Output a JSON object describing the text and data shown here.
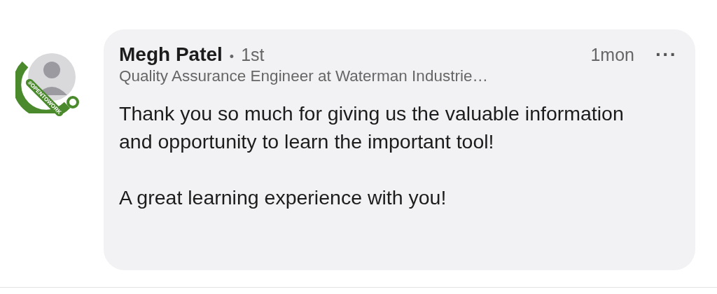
{
  "comment": {
    "author": "Megh Patel",
    "separator": "•",
    "degree": "1st",
    "headline": "Quality Assurance Engineer at Waterman Industrie…",
    "time": "1mon",
    "menu": "···",
    "avatar_badge": "#OPENTOWORK",
    "paragraphs": [
      "Thank you so much for giving us the valuable information and opportunity to learn the important tool!",
      "A great learning experience with you!"
    ]
  }
}
